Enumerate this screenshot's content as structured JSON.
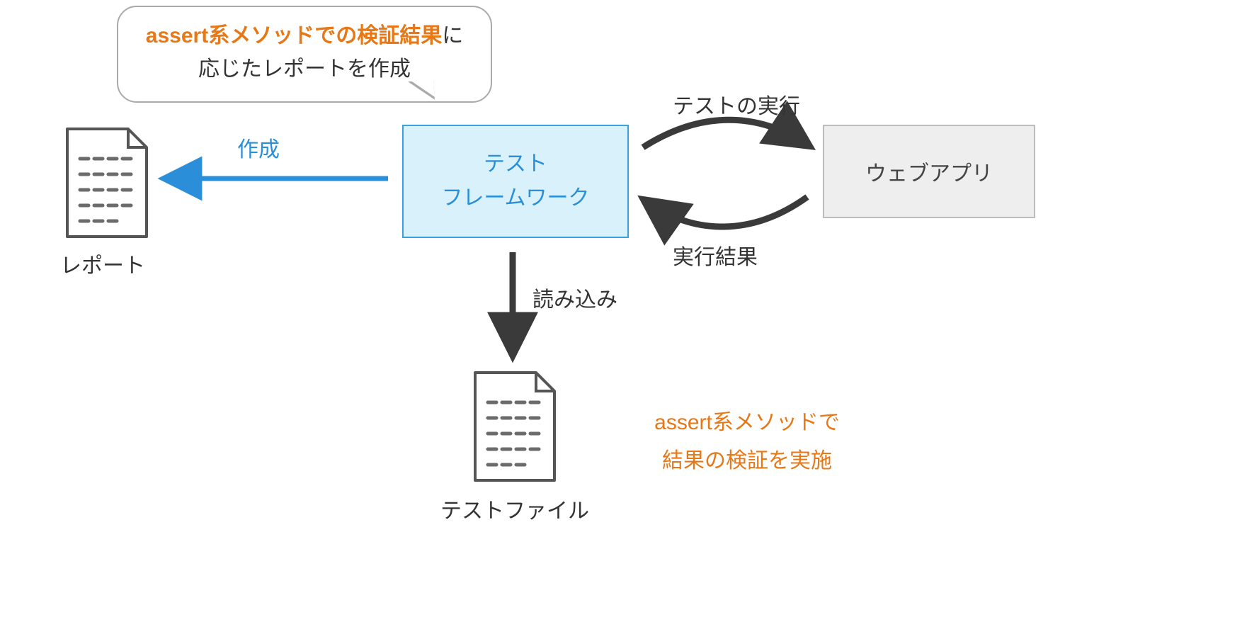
{
  "bubble": {
    "highlight": "assert系メソッドでの検証結果",
    "tail1": "に",
    "line2": "応じたレポートを作成"
  },
  "labels": {
    "create": "作成",
    "report_caption": "レポート",
    "framework_line1": "テスト",
    "framework_line2": "フレームワーク",
    "test_execute": "テストの実行",
    "execute_result": "実行結果",
    "webapp": "ウェブアプリ",
    "loading": "読み込み",
    "test_file_caption": "テストファイル"
  },
  "orange_note": {
    "line1": "assert系メソッドで",
    "line2": "結果の検証を実施"
  },
  "colors": {
    "accent_orange": "#e77817",
    "arrow_blue": "#2a8fd8",
    "arrow_dark": "#3a3a3a",
    "framework_fill": "#d8f1fb",
    "framework_border": "#3aa0e0",
    "webapp_fill": "#eeeeee",
    "webapp_border": "#bcbcbc",
    "ink": "#333333"
  }
}
